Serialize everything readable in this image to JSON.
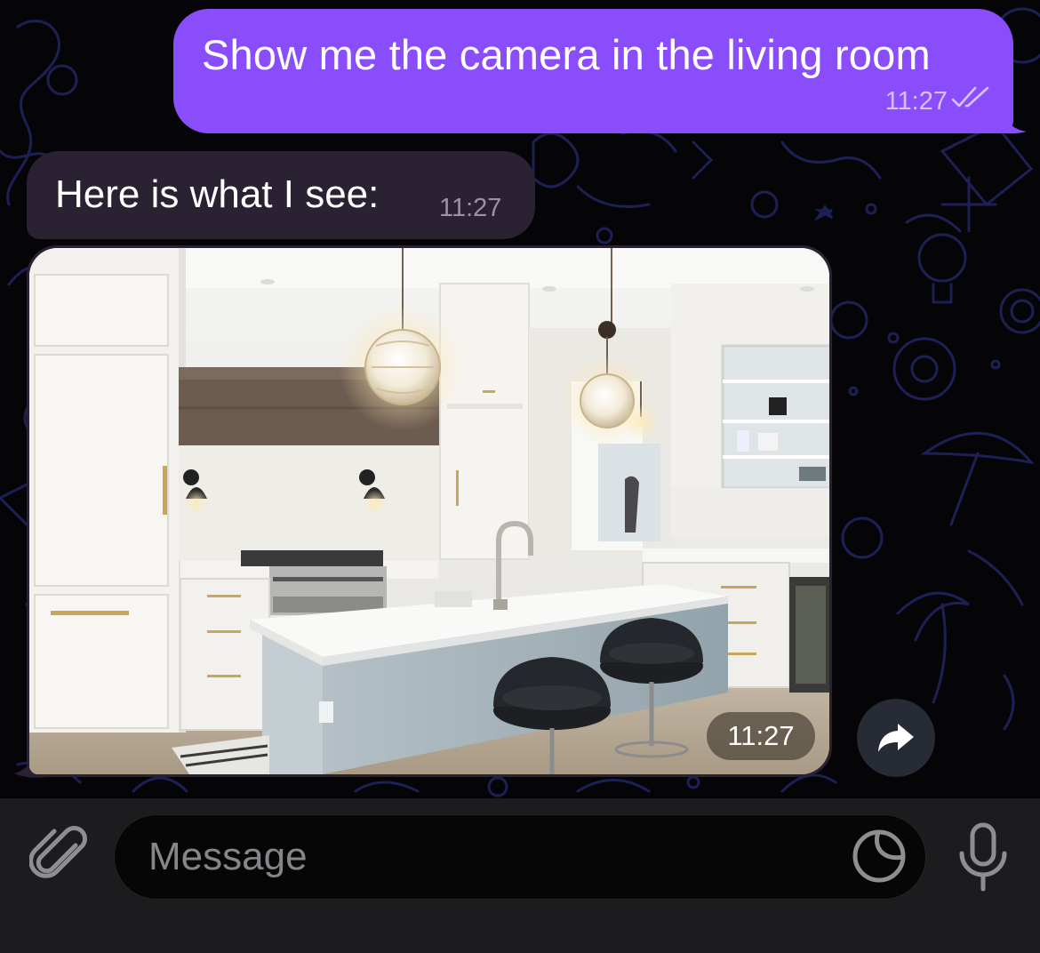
{
  "conversation": {
    "outgoing": {
      "text": "Show me the camera in the living room",
      "time": "11:27",
      "status_icon": "double-check-icon",
      "bubble_color": "#8a4dfc"
    },
    "incoming_text": {
      "text": "Here is what I see:",
      "time": "11:27",
      "bubble_color": "#2a2233"
    },
    "incoming_photo": {
      "image": "kitchen-photo",
      "time": "11:27"
    },
    "forward_icon": "forward-arrow-icon"
  },
  "composer": {
    "placeholder": "Message",
    "attach_icon": "paperclip-icon",
    "sticker_icon": "sticker-icon",
    "mic_icon": "microphone-icon"
  }
}
